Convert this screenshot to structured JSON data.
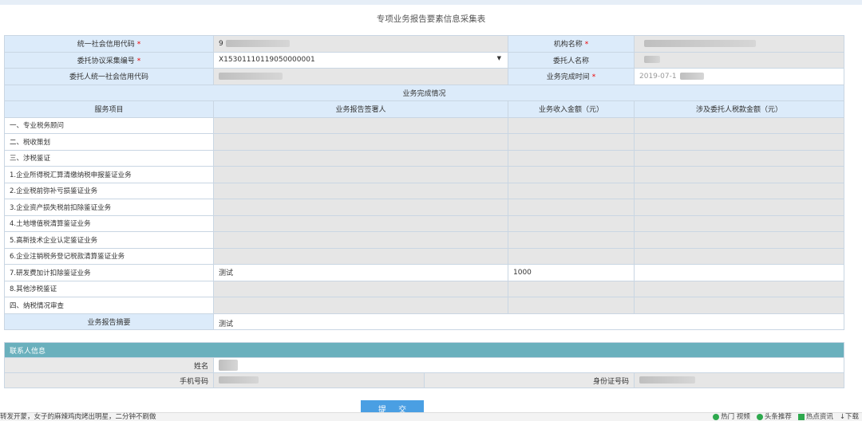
{
  "title": "专项业务报告要素信息采集表",
  "fields": {
    "credit_code_label": "统一社会信用代码",
    "credit_code_value": "9",
    "org_name_label": "机构名称",
    "agreement_no_label": "委托协议采集编号",
    "agreement_no_value": "X15301110119050000001",
    "client_name_label": "委托人名称",
    "client_credit_label": "委托人统一社会信用代码",
    "complete_time_label": "业务完成时间",
    "complete_time_value": "2019-07-1"
  },
  "section_title": "业务完成情况",
  "columns": [
    "服务项目",
    "业务报告签署人",
    "业务收入金额（元）",
    "涉及委托人税款金额（元）"
  ],
  "rows": [
    {
      "name": "一、专业税务顾问",
      "signer": "",
      "income": "",
      "tax": ""
    },
    {
      "name": "二、税收策划",
      "signer": "",
      "income": "",
      "tax": ""
    },
    {
      "name": "三、涉税鉴证",
      "signer": "",
      "income": "",
      "tax": ""
    },
    {
      "name": "1.企业所得税汇算清缴纳税申报鉴证业务",
      "signer": "",
      "income": "",
      "tax": ""
    },
    {
      "name": "2.企业税前弥补亏损鉴证业务",
      "signer": "",
      "income": "",
      "tax": ""
    },
    {
      "name": "3.企业资产损失税前扣除鉴证业务",
      "signer": "",
      "income": "",
      "tax": ""
    },
    {
      "name": "4.土地增值税清算鉴证业务",
      "signer": "",
      "income": "",
      "tax": ""
    },
    {
      "name": "5.高新技术企业认定鉴证业务",
      "signer": "",
      "income": "",
      "tax": ""
    },
    {
      "name": "6.企业注销税务登记税款清算鉴证业务",
      "signer": "",
      "income": "",
      "tax": ""
    },
    {
      "name": "7.研发费加计扣除鉴证业务",
      "signer": "测试",
      "income": "1000",
      "tax": ""
    },
    {
      "name": "8.其他涉税鉴证",
      "signer": "",
      "income": "",
      "tax": ""
    },
    {
      "name": "四、纳税情况审查",
      "signer": "",
      "income": "",
      "tax": ""
    }
  ],
  "summary_label": "业务报告摘要",
  "summary_value": "测试",
  "contact": {
    "header": "联系人信息",
    "name_label": "姓名",
    "phone_label": "手机号码",
    "id_label": "身份证号码"
  },
  "submit_label": "提 交",
  "bottom_bar": {
    "left_text": "转发开蒙，女子的麻辣鸡肉烤出明星，二分钟不刷做",
    "items": [
      "热门 视频",
      "头条推荐",
      "热点资讯",
      "下载"
    ]
  }
}
